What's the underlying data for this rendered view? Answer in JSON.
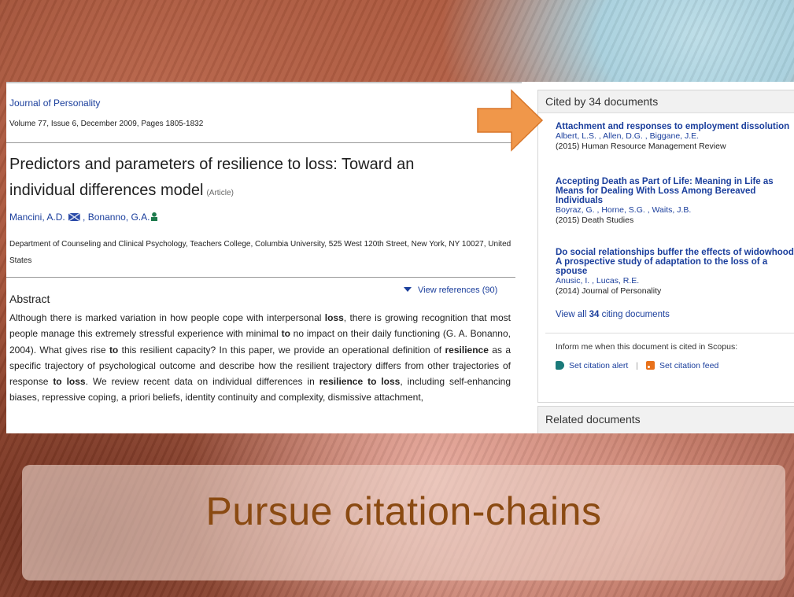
{
  "slide": {
    "caption": "Pursue citation-chains"
  },
  "article": {
    "journal": "Journal of Personality",
    "volume_info": "Volume 77, Issue 6, December 2009, Pages 1805-1832",
    "title_line1": "Predictors and parameters of resilience to loss: Toward an",
    "title_line2": "individual differences model",
    "article_type": "(Article)",
    "author1": "Mancini, A.D.",
    "author_sep": ",",
    "author2": "Bonanno, G.A.",
    "affiliation": "Department of Counseling and Clinical Psychology, Teachers College, Columbia University, 525 West 120th Street, New York, NY 10027, United States",
    "abstract_heading": "Abstract",
    "view_references": "View references (90)",
    "abstract_segments": [
      {
        "t": "Although there is marked variation in how people cope with interpersonal ",
        "b": false
      },
      {
        "t": "loss",
        "b": true
      },
      {
        "t": ", there is growing recognition that most people manage this extremely stressful experience with minimal ",
        "b": false
      },
      {
        "t": "to",
        "b": true
      },
      {
        "t": " no impact on their daily functioning (G. A. Bonanno, 2004). What gives rise ",
        "b": false
      },
      {
        "t": "to",
        "b": true
      },
      {
        "t": " this resilient capacity? In this paper, we provide an operational definition of ",
        "b": false
      },
      {
        "t": "resilience",
        "b": true
      },
      {
        "t": " as a specific trajectory of psychological outcome and describe how the resilient trajectory differs from other trajectories of response ",
        "b": false
      },
      {
        "t": "to loss",
        "b": true
      },
      {
        "t": ". We review recent data on individual differences in ",
        "b": false
      },
      {
        "t": "resilience to loss",
        "b": true
      },
      {
        "t": ", including self-enhancing biases, repressive coping, a priori beliefs, identity continuity and complexity, dismissive attachment,",
        "b": false
      }
    ]
  },
  "sidebar": {
    "cited_title": "Cited by 34 documents",
    "citations": [
      {
        "title": "Attachment and responses to employment dissolution",
        "authors": "Albert, L.S. , Allen, D.G. , Biggane, J.E.",
        "source": "(2015) Human Resource Management Review"
      },
      {
        "title": "Accepting Death as Part of Life: Meaning in Life as Means for Dealing With Loss Among Bereaved Individuals",
        "authors": "Boyraz, G. , Horne, S.G. , Waits, J.B.",
        "source": "(2015) Death Studies"
      },
      {
        "title": "Do social relationships buffer the effects of widowhood? A prospective study of adaptation to the loss of a spouse",
        "authors": "Anusic, I. , Lucas, R.E.",
        "source": "(2014) Journal of Personality"
      }
    ],
    "view_all_pre": "View all ",
    "view_all_count": "34",
    "view_all_post": " citing documents",
    "inform_text": "Inform me when this document is cited in Scopus:",
    "set_alert": "Set citation alert",
    "separator": "|",
    "set_feed": "Set citation feed",
    "related_title": "Related documents"
  },
  "colors": {
    "link": "#1a3e9c",
    "arrow": "#f0974a",
    "caption": "#8a4a12"
  },
  "icons": [
    "mail-icon",
    "person-icon",
    "triangle-down-icon",
    "bell-icon",
    "rss-icon",
    "arrow-icon"
  ]
}
